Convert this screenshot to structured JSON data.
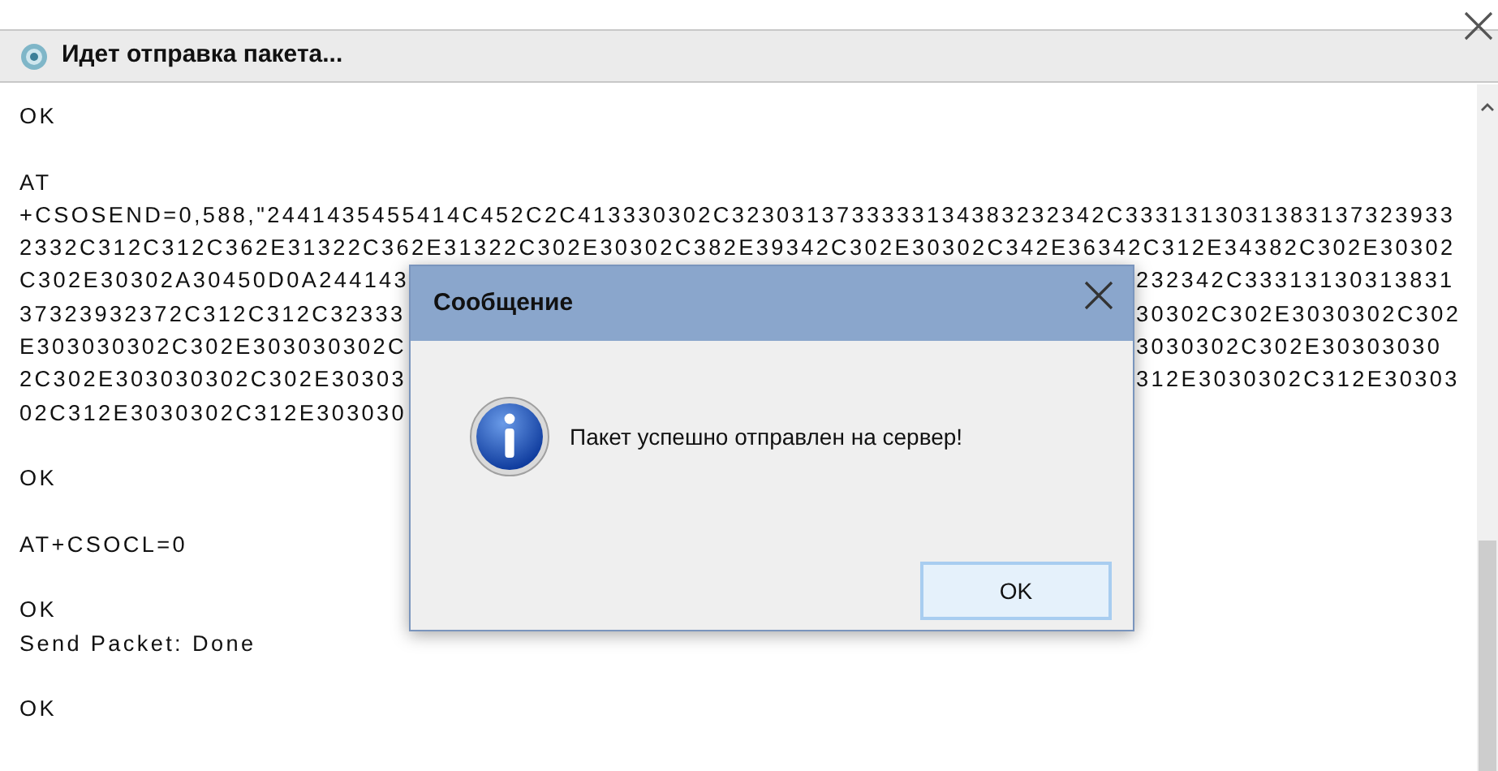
{
  "window": {
    "title": "Идет отправка пакета..."
  },
  "log": [
    {
      "kind": "line",
      "text": "OK"
    },
    {
      "kind": "blank"
    },
    {
      "kind": "line",
      "text": "AT"
    },
    {
      "kind": "line",
      "text": "+CSOSEND=0,588,\"2441435455414C452C2C413330302C3230313733333134383232342C3331313031383137323933"
    },
    {
      "kind": "line",
      "text": "2332C312C312C362E31322C362E31322C302E30302C382E39342C302E30302C342E36342C312E34382C302E30302"
    },
    {
      "kind": "split",
      "left": "C302E30302A30450D0A244143",
      "right": "232342C33313130313831"
    },
    {
      "kind": "split",
      "left": "37323932372C312C312C32333",
      "right": "30302C302E3030302C302"
    },
    {
      "kind": "split",
      "left": "E303030302C302E303030302C",
      "right": "3030302C302E30303030"
    },
    {
      "kind": "split",
      "left": "2C302E303030302C302E30303",
      "right": "312E3030302C312E30303"
    },
    {
      "kind": "split",
      "left": "02C312E3030302C312E303030"
    },
    {
      "kind": "blank"
    },
    {
      "kind": "line",
      "text": "OK"
    },
    {
      "kind": "blank"
    },
    {
      "kind": "line",
      "text": "AT+CSOCL=0"
    },
    {
      "kind": "blank"
    },
    {
      "kind": "line",
      "text": "OK"
    },
    {
      "kind": "line",
      "text": "Send Packet: Done"
    },
    {
      "kind": "blank"
    },
    {
      "kind": "line",
      "text": "OK"
    }
  ],
  "dialog": {
    "title": "Сообщение",
    "message": "Пакет успешно отправлен на сервер!",
    "buttons": [
      "OK"
    ]
  }
}
